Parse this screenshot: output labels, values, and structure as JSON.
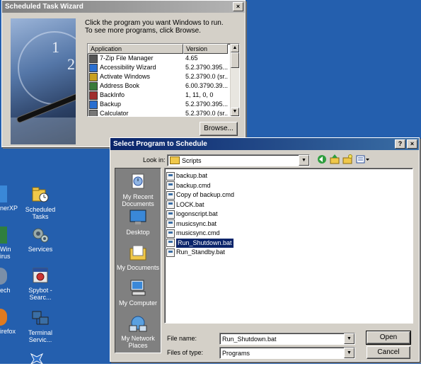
{
  "desktop": {
    "icons": [
      {
        "label": "nerXP",
        "name": "partial-icon-nerxp"
      },
      {
        "label": "Scheduled Tasks",
        "name": "scheduled-tasks-icon"
      },
      {
        "label": "Win irus",
        "name": "partial-icon-win"
      },
      {
        "label": "Services",
        "name": "services-icon"
      },
      {
        "label": "ech ",
        "name": "partial-icon-tech"
      },
      {
        "label": "Spybot - Searc...",
        "name": "spybot-icon"
      },
      {
        "label": "irefox",
        "name": "partial-icon-firefox"
      },
      {
        "label": "Terminal Servic...",
        "name": "terminal-services-icon"
      }
    ]
  },
  "wizard": {
    "title": "Scheduled Task Wizard",
    "instruction_line1": "Click the program you want Windows to run.",
    "instruction_line2": "To see more programs, click Browse.",
    "columns": [
      "Application",
      "Version"
    ],
    "rows": [
      {
        "app": "7-Zip File Manager",
        "version": "4.65",
        "icon": "7zip-icon"
      },
      {
        "app": "Accessibility Wizard",
        "version": "5.2.3790.395...",
        "icon": "accessibility-icon"
      },
      {
        "app": "Activate Windows",
        "version": "5.2.3790.0 (sr...",
        "icon": "key-icon"
      },
      {
        "app": "Address Book",
        "version": "6.00.3790.39...",
        "icon": "address-book-icon"
      },
      {
        "app": "BackInfo",
        "version": "1, 11, 0, 0",
        "icon": "backinfo-icon"
      },
      {
        "app": "Backup",
        "version": "5.2.3790.395...",
        "icon": "backup-icon"
      },
      {
        "app": "Calculator",
        "version": "5.2.3790.0 (sr...",
        "icon": "calculator-icon"
      }
    ],
    "browse_label": "Browse...",
    "close_glyph": "×"
  },
  "dialog": {
    "title": "Select Program to Schedule",
    "help_glyph": "?",
    "close_glyph": "×",
    "look_in_label": "Look in:",
    "look_in_value": "Scripts",
    "places": [
      {
        "label": "My Recent Documents",
        "name": "my-recent-documents"
      },
      {
        "label": "Desktop",
        "name": "desktop-place"
      },
      {
        "label": "My Documents",
        "name": "my-documents"
      },
      {
        "label": "My Computer",
        "name": "my-computer"
      },
      {
        "label": "My Network Places",
        "name": "my-network-places"
      }
    ],
    "files": [
      "backup.bat",
      "backup.cmd",
      "Copy of backup.cmd",
      "LOCK.bat",
      "logonscript.bat",
      "musicsync.bat",
      "musicsync.cmd",
      "Run_Shutdown.bat",
      "Run_Standby.bat"
    ],
    "selected_file": "Run_Shutdown.bat",
    "file_name_label": "File name:",
    "file_name_value": "Run_Shutdown.bat",
    "files_of_type_label": "Files of type:",
    "files_of_type_value": "Programs",
    "open_label": "Open",
    "cancel_label": "Cancel"
  }
}
